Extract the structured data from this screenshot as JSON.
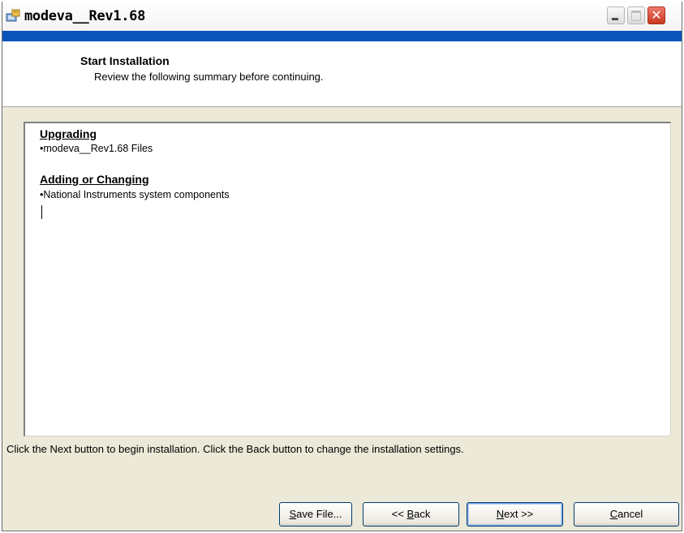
{
  "window": {
    "title": "modeva__Rev1.68",
    "controls": {
      "minimize": "minimize",
      "maximize": "maximize",
      "close": "✕"
    }
  },
  "header": {
    "title": "Start Installation",
    "subtitle": "Review the following summary before continuing."
  },
  "summary": {
    "sections": [
      {
        "heading": "Upgrading",
        "items": [
          "•modeva__Rev1.68 Files"
        ]
      },
      {
        "heading": "Adding or Changing",
        "items": [
          "•National Instruments system components"
        ]
      }
    ]
  },
  "footer": {
    "instruction": "Click the Next button to begin installation.  Click the Back button to change the installation settings."
  },
  "buttons": {
    "save_file": {
      "label": "Save File...",
      "mnemonic": "S"
    },
    "back": {
      "label": "<< Back",
      "mnemonic": "B"
    },
    "next": {
      "label": "Next >>",
      "mnemonic": "N"
    },
    "cancel": {
      "label": "Cancel",
      "mnemonic": "C"
    }
  },
  "colors": {
    "accent_bar": "#0a53b8",
    "dialog_bg": "#ece9d8",
    "close_button": "#c8371f"
  },
  "icons": [
    "installer-icon",
    "minimize-icon",
    "maximize-icon",
    "close-icon"
  ]
}
